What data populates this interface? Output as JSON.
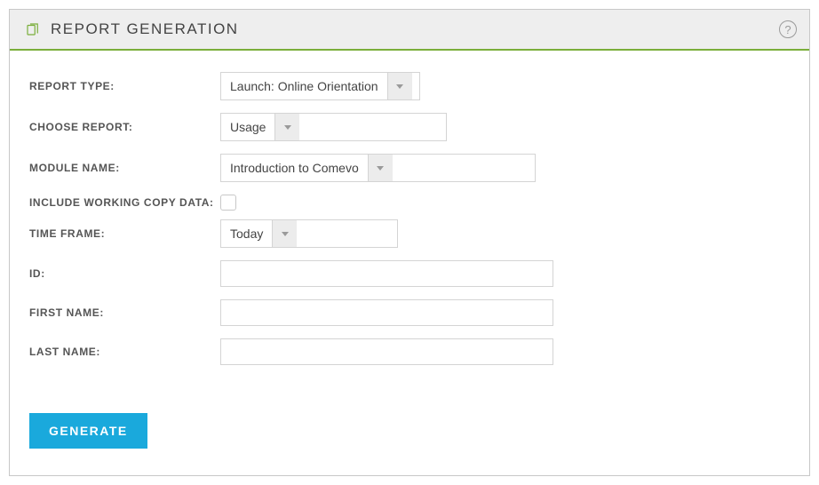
{
  "header": {
    "title": "REPORT GENERATION"
  },
  "form": {
    "report_type": {
      "label": "REPORT TYPE:",
      "value": "Launch: Online Orientation"
    },
    "choose_report": {
      "label": "CHOOSE REPORT:",
      "value": "Usage"
    },
    "module_name": {
      "label": "MODULE NAME:",
      "value": "Introduction to Comevo"
    },
    "include_working_copy": {
      "label": "INCLUDE WORKING COPY DATA:",
      "value": false
    },
    "time_frame": {
      "label": "TIME FRAME:",
      "value": "Today"
    },
    "id": {
      "label": "ID:",
      "value": ""
    },
    "first_name": {
      "label": "FIRST NAME:",
      "value": ""
    },
    "last_name": {
      "label": "LAST NAME:",
      "value": ""
    }
  },
  "buttons": {
    "generate": "GENERATE"
  }
}
